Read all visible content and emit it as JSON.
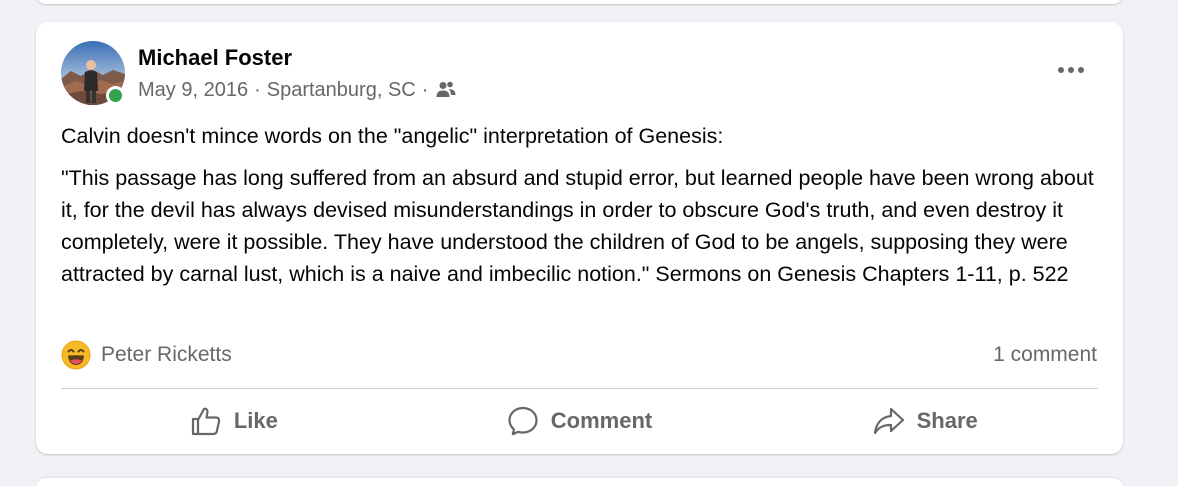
{
  "post": {
    "author": "Michael Foster",
    "date": "May 9, 2016",
    "separator": "·",
    "location": "Spartanburg, SC",
    "audience_icon": "friends-icon",
    "online": true,
    "paragraphs": [
      "Calvin doesn't mince words on the \"angelic\" interpretation of Genesis:",
      "\"This passage has long suffered from an absurd and stupid error, but learned people have been wrong about it, for the devil has always devised misunderstandings in order to obscure God's truth, and even destroy it completely, were it possible. They have understood the children of God to be angels, supposing they were attracted by carnal lust, which is a naive and imbecilic notion.\" Sermons on Genesis Chapters 1-11, p. 522"
    ],
    "reactions": {
      "emoji": "laughing-face-icon",
      "by": "Peter Ricketts"
    },
    "comment_count": "1 comment"
  },
  "actions": {
    "like": "Like",
    "comment": "Comment",
    "share": "Share"
  },
  "colors": {
    "background": "#f0f2f5",
    "card": "#ffffff",
    "secondary_text": "#65676b",
    "online": "#31a24c"
  }
}
